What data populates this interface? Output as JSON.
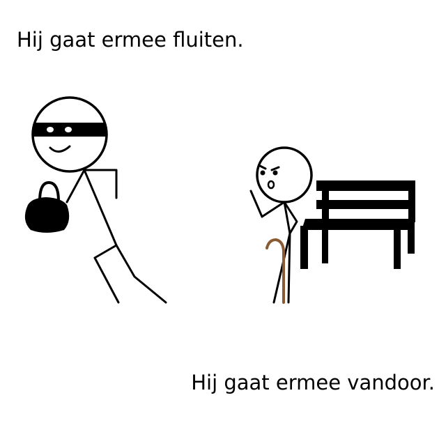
{
  "captions": {
    "top": "Hij gaat ermee fluiten.",
    "bottom": "Hij gaat ermee vandoor."
  },
  "colors": {
    "ink": "#000000",
    "cane": "#8a5a32",
    "background": "#ffffff"
  }
}
